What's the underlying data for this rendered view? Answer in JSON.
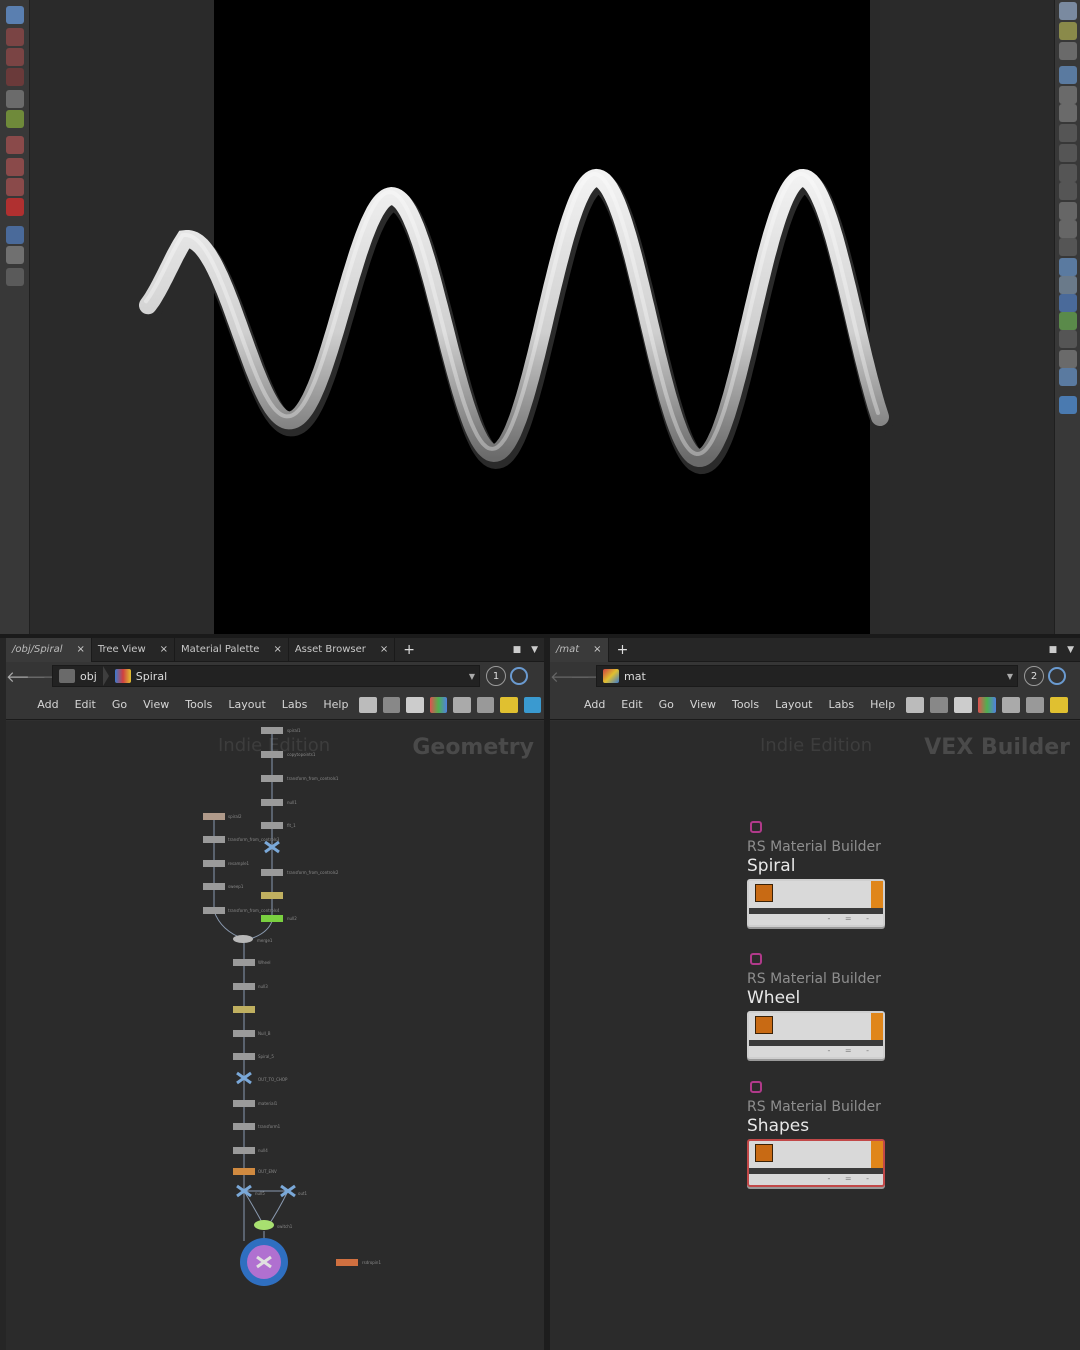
{
  "left_pane": {
    "tabs": [
      {
        "label": "/obj/Spiral",
        "active": true
      },
      {
        "label": "Tree View",
        "active": false
      },
      {
        "label": "Material Palette",
        "active": false
      },
      {
        "label": "Asset Browser",
        "active": false
      }
    ],
    "path": [
      {
        "label": "obj"
      },
      {
        "label": "Spiral"
      }
    ],
    "pin_number": "1",
    "menu": [
      "Add",
      "Edit",
      "Go",
      "View",
      "Tools",
      "Layout",
      "Labs",
      "Help"
    ],
    "watermark_edition": "Indie Edition",
    "context_label": "Geometry"
  },
  "right_pane": {
    "tabs": [
      {
        "label": "/mat",
        "active": true
      }
    ],
    "path": [
      {
        "label": "mat"
      }
    ],
    "pin_number": "2",
    "menu": [
      "Add",
      "Edit",
      "Go",
      "View",
      "Tools",
      "Layout",
      "Labs",
      "Help"
    ],
    "watermark_edition": "Indie Edition",
    "context_label": "VEX Builder",
    "materials": [
      {
        "type": "RS Material Builder",
        "name": "Spiral",
        "selected": false
      },
      {
        "type": "RS Material Builder",
        "name": "Wheel",
        "selected": false
      },
      {
        "type": "RS Material Builder",
        "name": "Shapes",
        "selected": true
      }
    ]
  },
  "colors": {
    "accent_orange": "#e0861a",
    "selected_border": "#c24848",
    "material_icon": "#b03a8a"
  }
}
